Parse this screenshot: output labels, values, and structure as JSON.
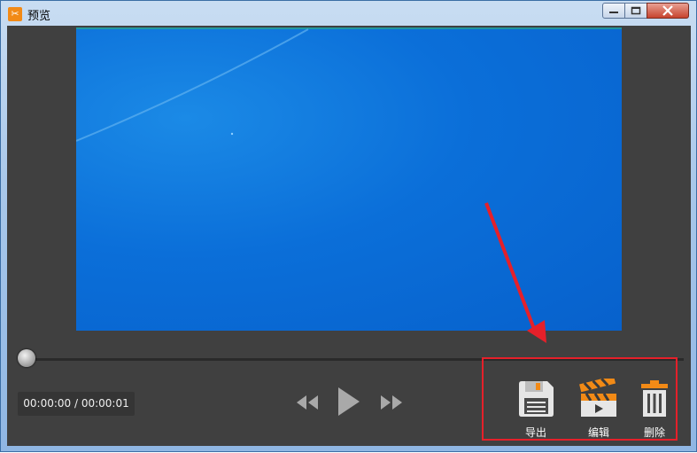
{
  "window": {
    "title": "预览",
    "app_icon_glyph": "✂",
    "controls": [
      "minimize",
      "maximize",
      "close"
    ]
  },
  "player": {
    "current_time": "00:00:00",
    "separator": " / ",
    "total_time": "00:00:01",
    "progress_fraction": 0
  },
  "actions": [
    {
      "label": "导出",
      "icon": "save-icon"
    },
    {
      "label": "编辑",
      "icon": "clapperboard-icon"
    },
    {
      "label": "删除",
      "icon": "trash-icon"
    }
  ],
  "colors": {
    "accent_orange": "#f28a16",
    "annotation_red": "#e5202a",
    "player_background": "#404040"
  }
}
